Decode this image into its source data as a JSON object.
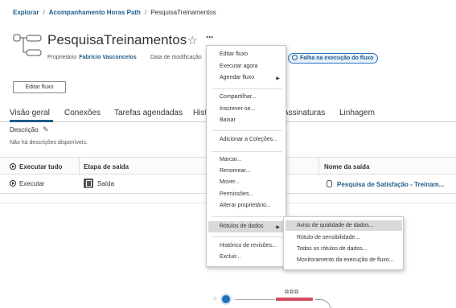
{
  "breadcrumb": {
    "explore": "Explorar",
    "project": "Acompanhamento Horas Path",
    "current": "PesquisaTreinamentos",
    "sep": "/"
  },
  "header": {
    "title": "PesquisaTreinamentos",
    "owner_label": "Proprietário",
    "owner_name": "Fabrício Vasconcelos",
    "modified_label": "Data de modificação",
    "fail_badge": "Falha na execução do fluxo",
    "edit_button": "Editar fluxo",
    "star_icon": "star-icon",
    "more_icon": "ellipsis-icon"
  },
  "tabs": [
    "Visão geral",
    "Conexões",
    "Tarefas agendadas",
    "Hist",
    "Assinaturas",
    "Linhagem"
  ],
  "description": {
    "label": "Descrição",
    "empty_text": "Não há descrições disponíveis."
  },
  "table": {
    "run_all": "Executar tudo",
    "col_stage": "Etapa de saída",
    "col_output": "Nome da saída",
    "row": {
      "run": "Executar",
      "stage": "Saída",
      "output": "Pesquisa de Satisfação - Treinam..."
    }
  },
  "menu": {
    "items": [
      "Editar fluxo",
      "Executar agora",
      "Agendar fluxo",
      "Compartilhar...",
      "Inscrever-se...",
      "Baixar",
      "Adicionar a Coleções...",
      "Marcar...",
      "Renomear...",
      "Mover...",
      "Permissões...",
      "Alterar proprietário...",
      "Rótulos de dados",
      "Histórico de revisões...",
      "Excluir..."
    ]
  },
  "submenu": {
    "items": [
      "Aviso de qualidade de dados...",
      "Rótulo de sensibilidade...",
      "Todos os rótulos de dados...",
      "Monitoramento da execução de fluxo..."
    ]
  },
  "colors": {
    "accent": "#1f5d8a",
    "badge_border": "#2a74c1",
    "node_red": "#d1495b",
    "node_blue": "#1f6fb5"
  }
}
